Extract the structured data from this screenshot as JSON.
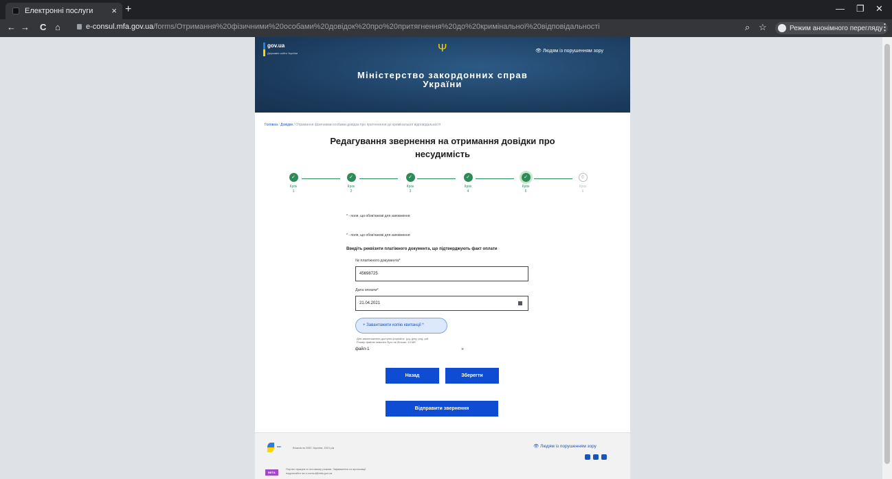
{
  "browser": {
    "tab_title": "Електронні послуги",
    "tab_close": "×",
    "new_tab": "+",
    "url_domain": "e-consul.mfa.gov.ua",
    "url_path": "/forms/Отримання%20фізичними%20особами%20довідок%20про%20притягнення%20до%20кримінальної%20відповідальності",
    "incognito_label": "Режим анонімного перегляду",
    "back": "←",
    "forward": "→",
    "reload": "C",
    "home": "⌂",
    "minimize": "—",
    "restore": "❐",
    "close": "✕",
    "zoom_icon": "⌕",
    "star_icon": "☆",
    "menu_icon": "⋮"
  },
  "header": {
    "govua": "gov.ua",
    "govua_sub": "Державні сайти України",
    "trident": "Ψ",
    "accessibility": "👁 Людям із порушенням зору",
    "ministry_line1": "Міністерство закордонних справ",
    "ministry_line2": "України"
  },
  "breadcrumbs": {
    "home": "Головна",
    "sep": " / ",
    "certs": "Довідки",
    "current": "Отримання фізичними особами довідок про притягнення до кримінальної відповідальності"
  },
  "form": {
    "title_line1": "Редагування звернення на отримання довідки про",
    "title_line2": "несудимість",
    "steps": [
      {
        "label_top": "Крок",
        "label_bottom": "1",
        "state": "done",
        "mark": "✓"
      },
      {
        "label_top": "Крок",
        "label_bottom": "2",
        "state": "done",
        "mark": "✓"
      },
      {
        "label_top": "Крок",
        "label_bottom": "3",
        "state": "done",
        "mark": "✓"
      },
      {
        "label_top": "Крок",
        "label_bottom": "4",
        "state": "done",
        "mark": "✓"
      },
      {
        "label_top": "Крок",
        "label_bottom": "5",
        "state": "active",
        "mark": "✓"
      },
      {
        "label_top": "Крок",
        "label_bottom": "6",
        "state": "pending",
        "mark": "6"
      }
    ],
    "required_note_1": "* - поля, що обов'язкові для заповнення",
    "required_note_2": "* - поля, що обов'язкові для заповнення",
    "section_title": "Введіть реквізити платіжного документа, що підтверджують факт оплати",
    "doc_number_label": "№ платіжного документа*",
    "doc_number_value": "45698725",
    "pay_date_label": "Дата оплати*",
    "pay_date_value": "21.04.2021",
    "upload_label": "+   Завантажити копію квитанції *",
    "hint_line1": "Для завантаження доступні формати: .jpg,.jpeg,.png,.pdf",
    "hint_line2": "Розмір файлів повинен бути не більше: 10 Мб",
    "file_name": "файл-1",
    "file_remove": "×",
    "back_button": "Назад",
    "save_button": "Зберегти",
    "submit_button": "Відправити звернення"
  },
  "footer": {
    "logo_text": "МЗС",
    "copyright": "Власність МЗС України, 2021 рік",
    "accessibility": "👁 Людям із порушенням зору",
    "beta": "BETA",
    "beta_line1": "Портал працює в тестовому режимі. Зауваження та пропозиції",
    "beta_line2": "надсилайте на e-consul@mfa.gov.ua",
    "social": [
      "facebook",
      "twitter",
      "youtube"
    ]
  },
  "colors": {
    "primary": "#0d4cd3",
    "step_done": "#2e8b57",
    "header_bg": "#1b3a5c",
    "beta": "#a24ac6"
  }
}
